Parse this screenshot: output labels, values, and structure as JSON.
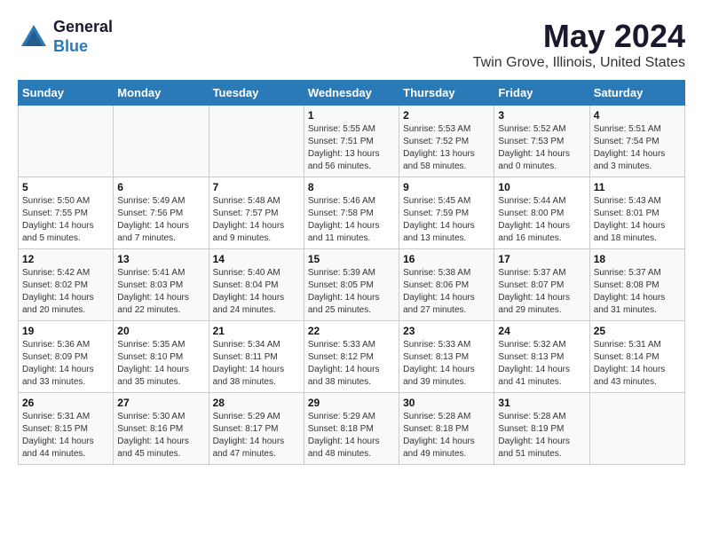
{
  "header": {
    "logo_general": "General",
    "logo_blue": "Blue",
    "month_year": "May 2024",
    "location": "Twin Grove, Illinois, United States"
  },
  "days_of_week": [
    "Sunday",
    "Monday",
    "Tuesday",
    "Wednesday",
    "Thursday",
    "Friday",
    "Saturday"
  ],
  "weeks": [
    [
      {
        "num": "",
        "detail": ""
      },
      {
        "num": "",
        "detail": ""
      },
      {
        "num": "",
        "detail": ""
      },
      {
        "num": "1",
        "detail": "Sunrise: 5:55 AM\nSunset: 7:51 PM\nDaylight: 13 hours\nand 56 minutes."
      },
      {
        "num": "2",
        "detail": "Sunrise: 5:53 AM\nSunset: 7:52 PM\nDaylight: 13 hours\nand 58 minutes."
      },
      {
        "num": "3",
        "detail": "Sunrise: 5:52 AM\nSunset: 7:53 PM\nDaylight: 14 hours\nand 0 minutes."
      },
      {
        "num": "4",
        "detail": "Sunrise: 5:51 AM\nSunset: 7:54 PM\nDaylight: 14 hours\nand 3 minutes."
      }
    ],
    [
      {
        "num": "5",
        "detail": "Sunrise: 5:50 AM\nSunset: 7:55 PM\nDaylight: 14 hours\nand 5 minutes."
      },
      {
        "num": "6",
        "detail": "Sunrise: 5:49 AM\nSunset: 7:56 PM\nDaylight: 14 hours\nand 7 minutes."
      },
      {
        "num": "7",
        "detail": "Sunrise: 5:48 AM\nSunset: 7:57 PM\nDaylight: 14 hours\nand 9 minutes."
      },
      {
        "num": "8",
        "detail": "Sunrise: 5:46 AM\nSunset: 7:58 PM\nDaylight: 14 hours\nand 11 minutes."
      },
      {
        "num": "9",
        "detail": "Sunrise: 5:45 AM\nSunset: 7:59 PM\nDaylight: 14 hours\nand 13 minutes."
      },
      {
        "num": "10",
        "detail": "Sunrise: 5:44 AM\nSunset: 8:00 PM\nDaylight: 14 hours\nand 16 minutes."
      },
      {
        "num": "11",
        "detail": "Sunrise: 5:43 AM\nSunset: 8:01 PM\nDaylight: 14 hours\nand 18 minutes."
      }
    ],
    [
      {
        "num": "12",
        "detail": "Sunrise: 5:42 AM\nSunset: 8:02 PM\nDaylight: 14 hours\nand 20 minutes."
      },
      {
        "num": "13",
        "detail": "Sunrise: 5:41 AM\nSunset: 8:03 PM\nDaylight: 14 hours\nand 22 minutes."
      },
      {
        "num": "14",
        "detail": "Sunrise: 5:40 AM\nSunset: 8:04 PM\nDaylight: 14 hours\nand 24 minutes."
      },
      {
        "num": "15",
        "detail": "Sunrise: 5:39 AM\nSunset: 8:05 PM\nDaylight: 14 hours\nand 25 minutes."
      },
      {
        "num": "16",
        "detail": "Sunrise: 5:38 AM\nSunset: 8:06 PM\nDaylight: 14 hours\nand 27 minutes."
      },
      {
        "num": "17",
        "detail": "Sunrise: 5:37 AM\nSunset: 8:07 PM\nDaylight: 14 hours\nand 29 minutes."
      },
      {
        "num": "18",
        "detail": "Sunrise: 5:37 AM\nSunset: 8:08 PM\nDaylight: 14 hours\nand 31 minutes."
      }
    ],
    [
      {
        "num": "19",
        "detail": "Sunrise: 5:36 AM\nSunset: 8:09 PM\nDaylight: 14 hours\nand 33 minutes."
      },
      {
        "num": "20",
        "detail": "Sunrise: 5:35 AM\nSunset: 8:10 PM\nDaylight: 14 hours\nand 35 minutes."
      },
      {
        "num": "21",
        "detail": "Sunrise: 5:34 AM\nSunset: 8:11 PM\nDaylight: 14 hours\nand 38 minutes."
      },
      {
        "num": "22",
        "detail": "Sunrise: 5:33 AM\nSunset: 8:12 PM\nDaylight: 14 hours\nand 38 minutes."
      },
      {
        "num": "23",
        "detail": "Sunrise: 5:33 AM\nSunset: 8:13 PM\nDaylight: 14 hours\nand 39 minutes."
      },
      {
        "num": "24",
        "detail": "Sunrise: 5:32 AM\nSunset: 8:13 PM\nDaylight: 14 hours\nand 41 minutes."
      },
      {
        "num": "25",
        "detail": "Sunrise: 5:31 AM\nSunset: 8:14 PM\nDaylight: 14 hours\nand 43 minutes."
      }
    ],
    [
      {
        "num": "26",
        "detail": "Sunrise: 5:31 AM\nSunset: 8:15 PM\nDaylight: 14 hours\nand 44 minutes."
      },
      {
        "num": "27",
        "detail": "Sunrise: 5:30 AM\nSunset: 8:16 PM\nDaylight: 14 hours\nand 45 minutes."
      },
      {
        "num": "28",
        "detail": "Sunrise: 5:29 AM\nSunset: 8:17 PM\nDaylight: 14 hours\nand 47 minutes."
      },
      {
        "num": "29",
        "detail": "Sunrise: 5:29 AM\nSunset: 8:18 PM\nDaylight: 14 hours\nand 48 minutes."
      },
      {
        "num": "30",
        "detail": "Sunrise: 5:28 AM\nSunset: 8:18 PM\nDaylight: 14 hours\nand 49 minutes."
      },
      {
        "num": "31",
        "detail": "Sunrise: 5:28 AM\nSunset: 8:19 PM\nDaylight: 14 hours\nand 51 minutes."
      },
      {
        "num": "",
        "detail": ""
      }
    ]
  ]
}
